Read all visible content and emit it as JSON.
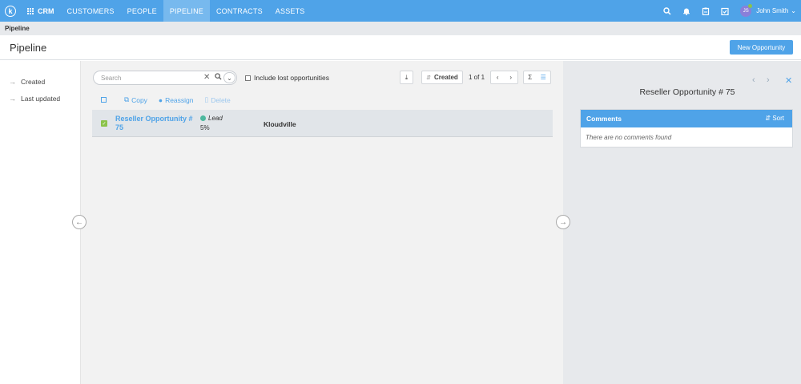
{
  "nav": {
    "logo": "k",
    "app": "CRM",
    "items": [
      {
        "label": "CUSTOMERS",
        "active": false
      },
      {
        "label": "PEOPLE",
        "active": false
      },
      {
        "label": "PIPELINE",
        "active": true
      },
      {
        "label": "CONTRACTS",
        "active": false
      },
      {
        "label": "ASSETS",
        "active": false
      }
    ],
    "icons": [
      "search-icon",
      "bell-icon",
      "clipboard-icon",
      "calendar-check-icon"
    ],
    "avatar": "JS",
    "user": "John Smith"
  },
  "breadcrumb": "Pipeline",
  "page_title": "Pipeline",
  "new_button": "New Opportunity",
  "sidebar": {
    "items": [
      "Created",
      "Last updated"
    ]
  },
  "toolbar": {
    "search_placeholder": "Search",
    "include_lost": "Include lost opportunities",
    "sort_label": "Created",
    "pagination": "1 of 1"
  },
  "actions": {
    "copy": "Copy",
    "reassign": "Reassign",
    "delete": "Delete"
  },
  "rows": [
    {
      "title": "Reseller Opportunity # 75",
      "stage": "Lead",
      "probability": "5%",
      "account": "Kloudville"
    }
  ],
  "detail": {
    "title": "Reseller Opportunity # 75",
    "comments_header": "Comments",
    "sort_label": "Sort",
    "empty_text": "There are no comments found"
  },
  "colors": {
    "accent": "#4fa3e8",
    "stage_lead": "#4cb89e",
    "checked": "#8bc34a"
  }
}
